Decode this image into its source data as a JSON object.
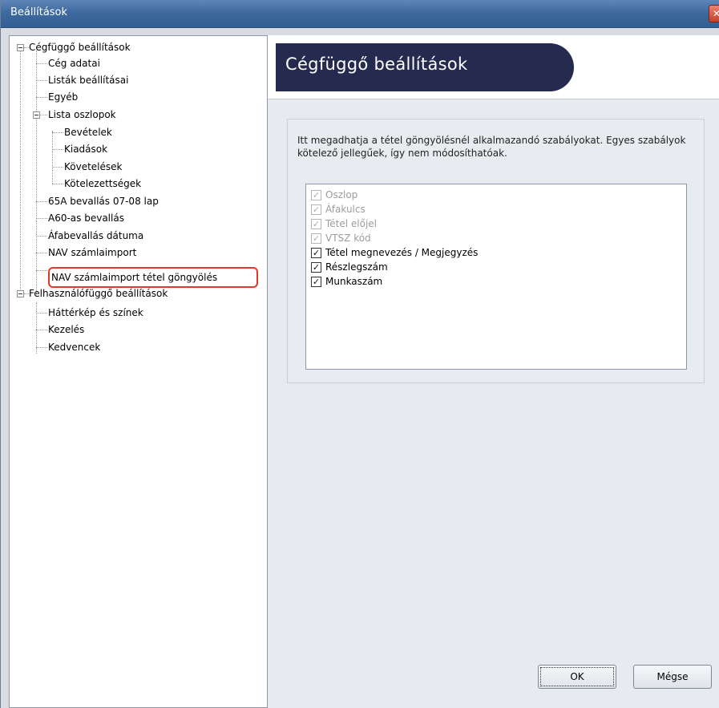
{
  "window": {
    "title": "Beállítások",
    "close_glyph": "✕"
  },
  "tree": {
    "items": [
      {
        "label": "Cégfüggő beállítások"
      },
      {
        "label": "Cég adatai"
      },
      {
        "label": "Listák beállításai"
      },
      {
        "label": "Egyéb"
      },
      {
        "label": "Lista oszlopok"
      },
      {
        "label": "Bevételek"
      },
      {
        "label": "Kiadások"
      },
      {
        "label": "Követelések"
      },
      {
        "label": "Kötelezettségek"
      },
      {
        "label": "65A bevallás 07-08 lap"
      },
      {
        "label": "A60-as bevallás"
      },
      {
        "label": "Áfabevallás dátuma"
      },
      {
        "label": "NAV számlaimport"
      },
      {
        "label": "NAV számlaimport tétel göngyölés"
      },
      {
        "label": "Felhasználófüggő beállítások"
      },
      {
        "label": "Háttérkép és színek"
      },
      {
        "label": "Kezelés"
      },
      {
        "label": "Kedvencek"
      }
    ],
    "selected_item": "NAV számlaimport tétel göngyölés"
  },
  "header": {
    "title": "Cégfüggő beállítások"
  },
  "panel": {
    "description": "Itt megadhatja a tétel göngyölésnél alkalmazandó szabályokat. Egyes szabályok kötelező jellegűek, így nem módosíthatóak.",
    "options": [
      {
        "label": "Oszlop",
        "checked": true,
        "enabled": false,
        "mark": "✓"
      },
      {
        "label": "Áfakulcs",
        "checked": true,
        "enabled": false,
        "mark": "✓"
      },
      {
        "label": "Tétel előjel",
        "checked": true,
        "enabled": false,
        "mark": "✓"
      },
      {
        "label": "VTSZ kód",
        "checked": true,
        "enabled": false,
        "mark": "✓"
      },
      {
        "label": "Tétel megnevezés / Megjegyzés",
        "checked": true,
        "enabled": true,
        "mark": "✓"
      },
      {
        "label": "Részlegszám",
        "checked": true,
        "enabled": true,
        "mark": "✓"
      },
      {
        "label": "Munkaszám",
        "checked": true,
        "enabled": true,
        "mark": "✓"
      }
    ]
  },
  "buttons": {
    "ok": "OK",
    "cancel": "Mégse"
  },
  "colors": {
    "title_bar": "#3f6aa0",
    "header_tab": "#252b4f",
    "selection_outline": "#e0382b"
  }
}
